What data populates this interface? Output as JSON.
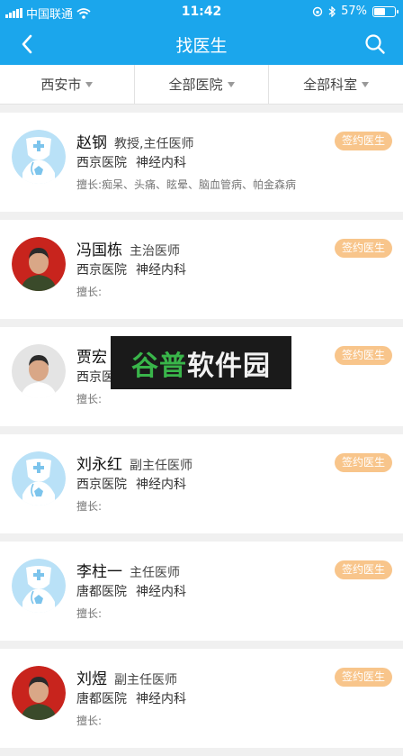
{
  "status_bar": {
    "carrier": "中国联通",
    "time": "11:42",
    "battery_text": "57%",
    "battery_level": 0.57
  },
  "nav": {
    "title": "找医生",
    "back_icon": "back-arrow-icon",
    "search_icon": "search-icon"
  },
  "filters": [
    {
      "label": "西安市"
    },
    {
      "label": "全部医院"
    },
    {
      "label": "全部科室"
    }
  ],
  "doctors": [
    {
      "name": "赵钢",
      "title": "教授,主任医师",
      "hospital": "西京医院",
      "department": "神经内科",
      "specialty": "擅长:痴呆、头痛、眩晕、脑血管病、帕金森病",
      "action": "签约医生",
      "avatar": "default"
    },
    {
      "name": "冯国栋",
      "title": "主治医师",
      "hospital": "西京医院",
      "department": "神经内科",
      "specialty": "擅长:",
      "action": "签约医生",
      "avatar": "photo-red"
    },
    {
      "name": "贾宏",
      "title": "",
      "hospital": "西京医",
      "department": "",
      "specialty": "擅长:",
      "action": "签约医生",
      "avatar": "photo-light"
    },
    {
      "name": "刘永红",
      "title": "副主任医师",
      "hospital": "西京医院",
      "department": "神经内科",
      "specialty": "擅长:",
      "action": "签约医生",
      "avatar": "default"
    },
    {
      "name": "李柱一",
      "title": "主任医师",
      "hospital": "唐都医院",
      "department": "神经内科",
      "specialty": "擅长:",
      "action": "签约医生",
      "avatar": "default"
    },
    {
      "name": "刘煜",
      "title": "副主任医师",
      "hospital": "唐都医院",
      "department": "神经内科",
      "specialty": "擅长:",
      "action": "签约医生",
      "avatar": "photo-red"
    }
  ],
  "watermark": {
    "green": "谷普",
    "white": "软件园"
  },
  "colors": {
    "primary": "#1ba6ec",
    "sign_button": "#f8c58b",
    "background": "#f0f0f0"
  }
}
